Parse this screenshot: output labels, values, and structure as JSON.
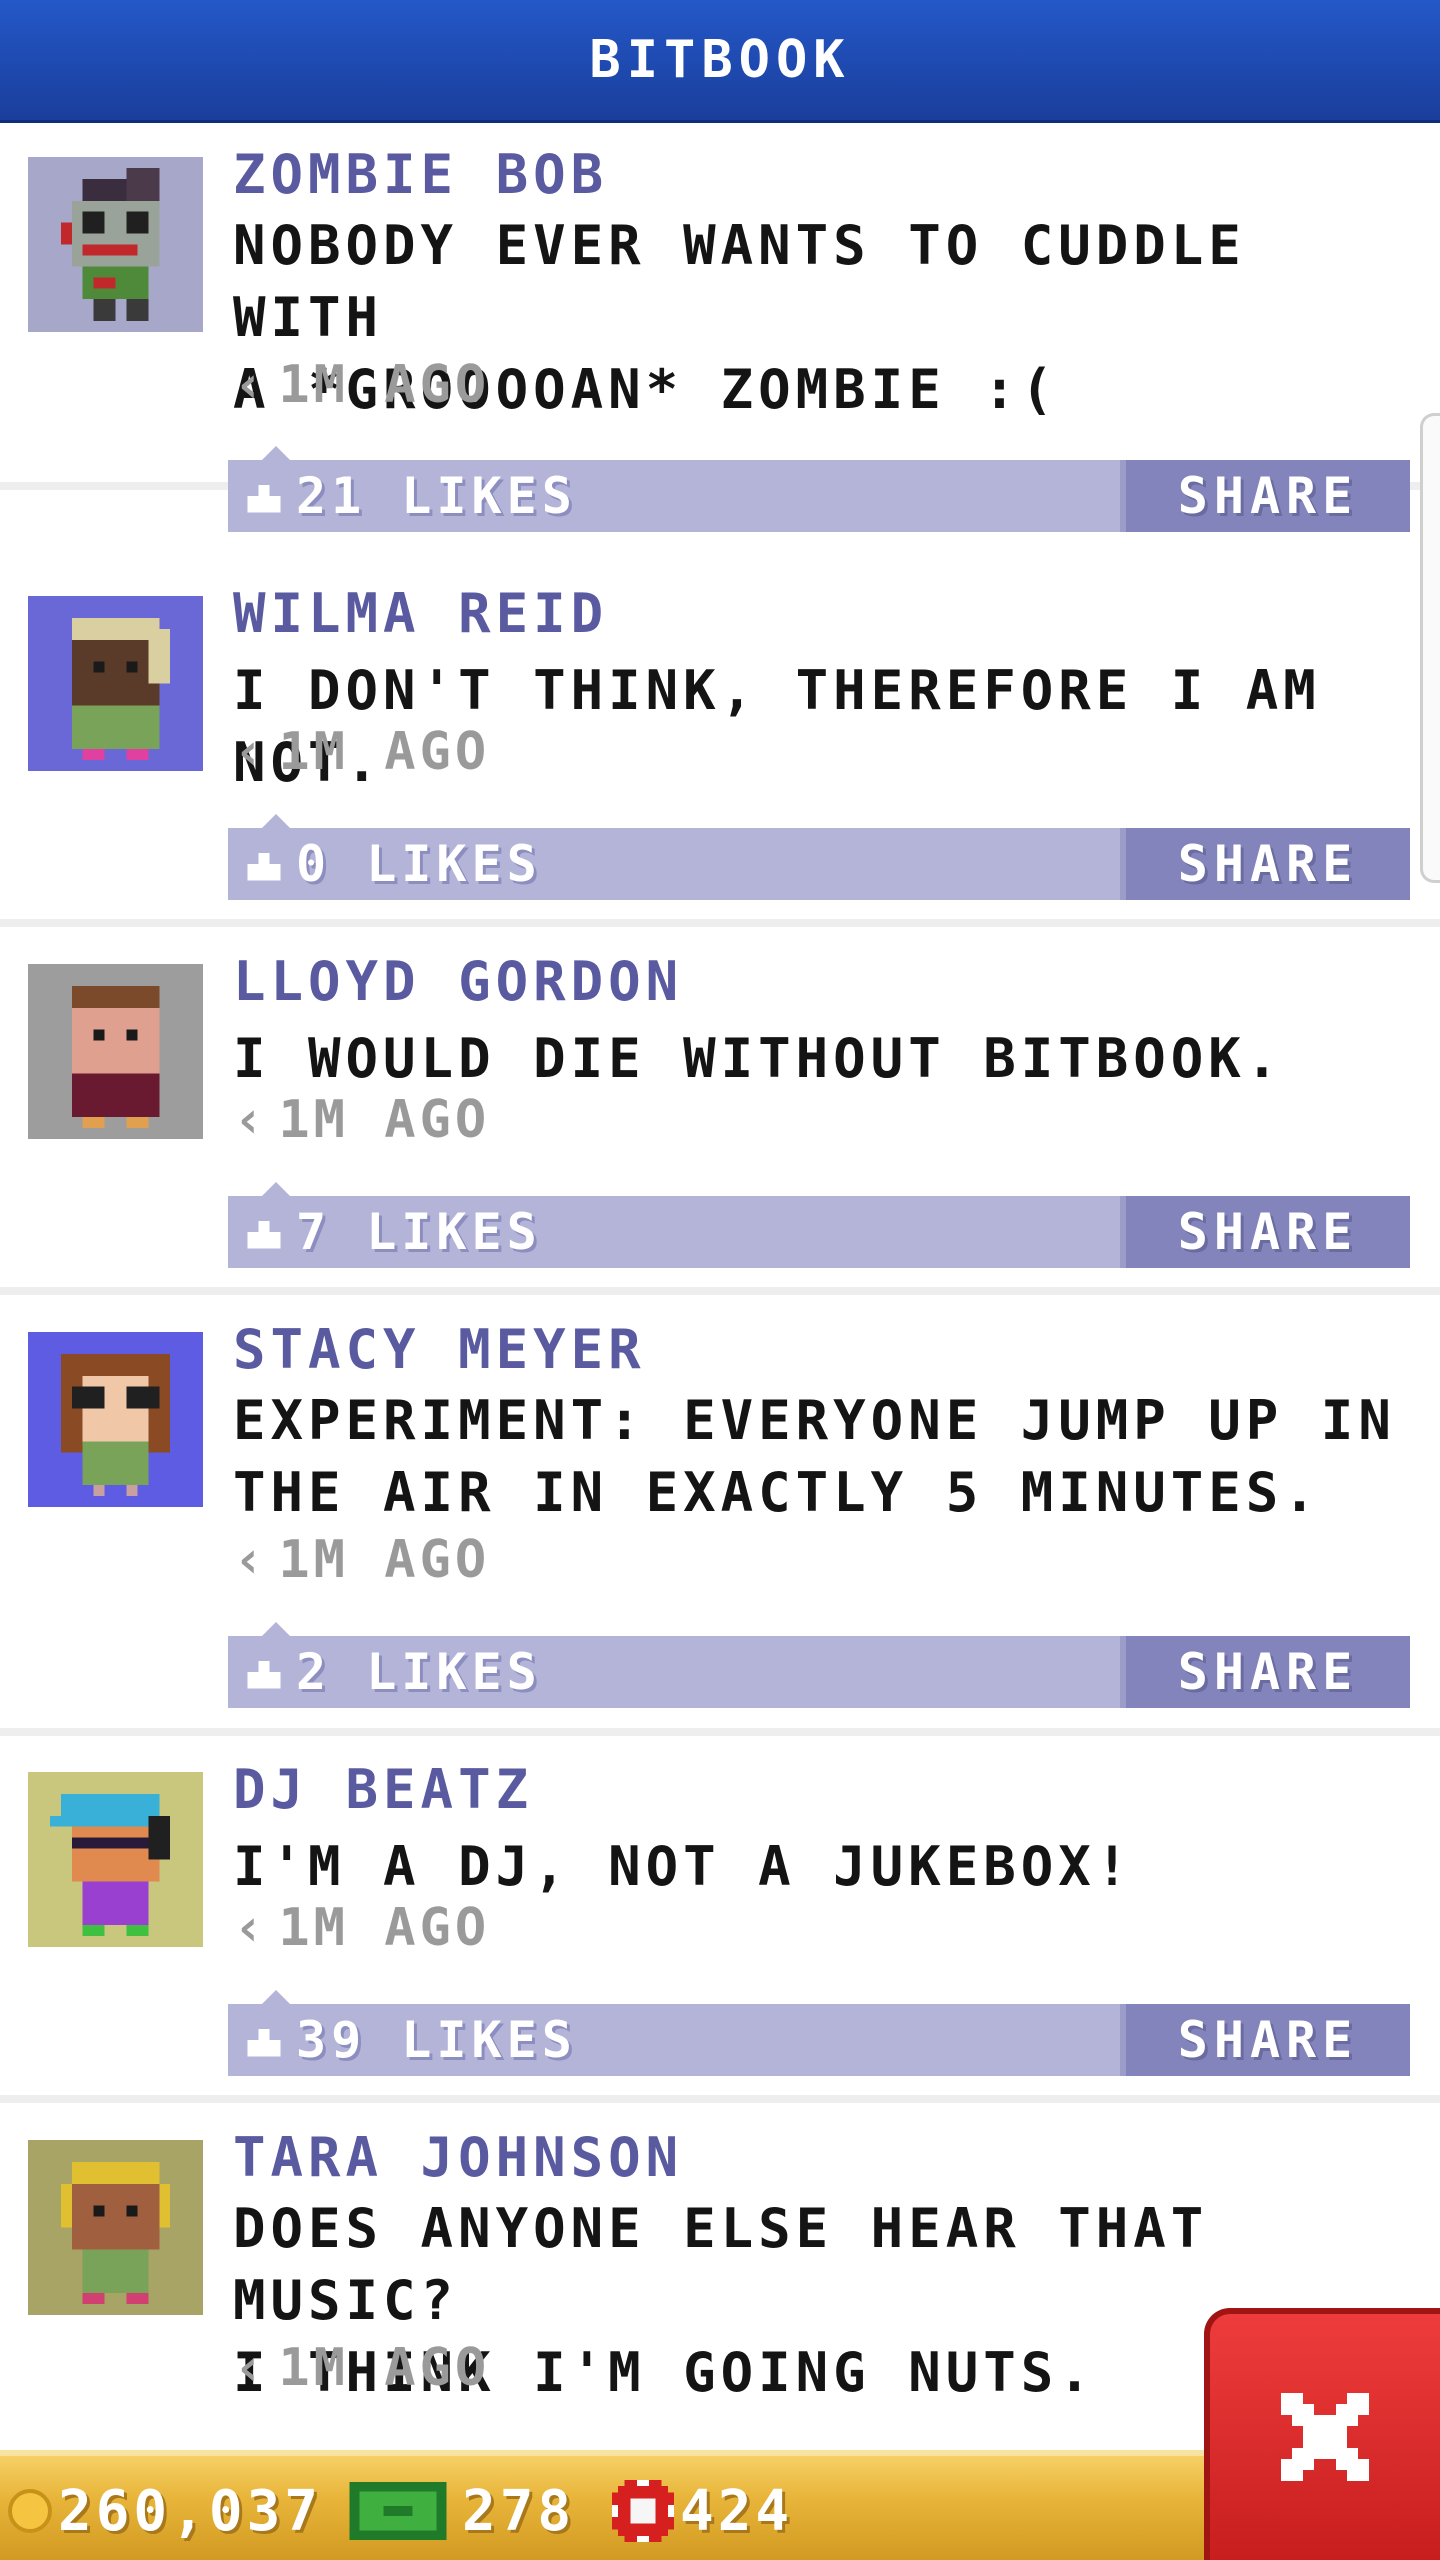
{
  "header": {
    "title": "BITBOOK"
  },
  "posts": [
    {
      "name": "ZOMBIE BOB",
      "lines": [
        "NOBODY EVER WANTS TO CUDDLE WITH",
        "A *GROOOOAN* ZOMBIE :("
      ],
      "time": "1M AGO",
      "likes": "21 LIKES",
      "share": "SHARE",
      "avatar_bg": "#a7a7c9",
      "avatar": "zombie"
    },
    {
      "name": "WILMA REID",
      "lines": [
        "I DON'T THINK, THEREFORE I AM NOT."
      ],
      "time": "1M AGO",
      "likes": "0 LIKES",
      "share": "SHARE",
      "avatar_bg": "#6a67d6",
      "avatar": "person-dark-blonde"
    },
    {
      "name": "LLOYD GORDON",
      "lines": [
        "I WOULD DIE WITHOUT BITBOOK."
      ],
      "time": "1M AGO",
      "likes": "7 LIKES",
      "share": "SHARE",
      "avatar_bg": "#9d9d9d",
      "avatar": "person-brown-hair"
    },
    {
      "name": "STACY MEYER",
      "lines": [
        "EXPERIMENT: EVERYONE JUMP UP IN",
        "THE AIR IN EXACTLY 5 MINUTES."
      ],
      "time": "1M AGO",
      "likes": "2 LIKES",
      "share": "SHARE",
      "avatar_bg": "#5e5ce2",
      "avatar": "person-glasses"
    },
    {
      "name": "DJ BEATZ",
      "lines": [
        "I'M A DJ, NOT A JUKEBOX!"
      ],
      "time": "1M AGO",
      "likes": "39 LIKES",
      "share": "SHARE",
      "avatar_bg": "#c9c67e",
      "avatar": "dj-headphones"
    },
    {
      "name": "TARA JOHNSON",
      "lines": [
        "DOES ANYONE ELSE HEAR THAT MUSIC?",
        "I THINK I'M GOING NUTS."
      ],
      "time": "1M AGO",
      "likes": "",
      "share": "",
      "avatar_bg": "#a7a466",
      "avatar": "person-headphones"
    }
  ],
  "footer": {
    "coins": "260,037",
    "bux": "278",
    "chips": "424"
  },
  "close_button": {
    "icon": "close-icon"
  }
}
